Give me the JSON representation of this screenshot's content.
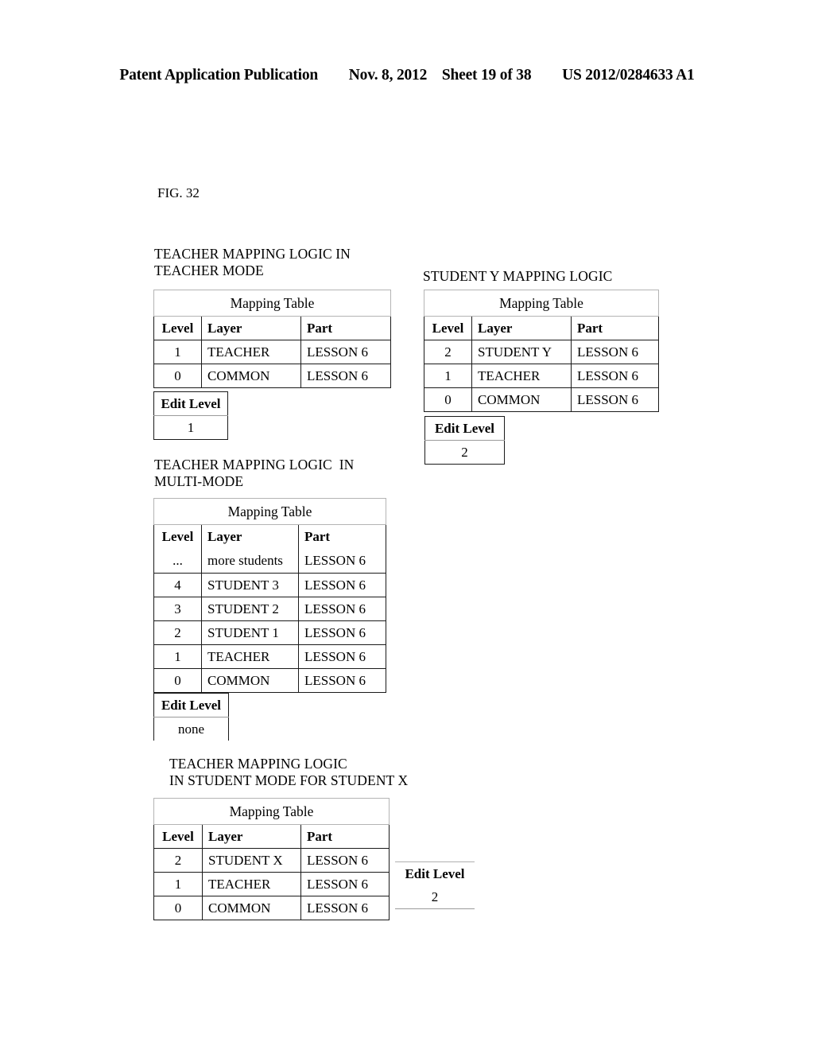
{
  "page_header": {
    "publication": "Patent Application Publication",
    "date": "Nov. 8, 2012",
    "sheet": "Sheet 19 of 38",
    "patent_number": "US 2012/0284633 A1"
  },
  "figure": {
    "label": "FIG. 32"
  },
  "columns": {
    "level": "Level",
    "layer": "Layer",
    "part": "Part"
  },
  "table_title": "Mapping Table",
  "edit_level_label": "Edit Level",
  "sections": {
    "teacher_mode": {
      "caption": "TEACHER MAPPING LOGIC IN\nTEACHER MODE",
      "table_title": "Mapping Table",
      "headers": [
        "Level",
        "Layer",
        "Part"
      ],
      "rows": [
        {
          "level": "1",
          "layer": "TEACHER",
          "part": "LESSON 6"
        },
        {
          "level": "0",
          "layer": "COMMON",
          "part": "LESSON 6"
        }
      ],
      "edit_level_label": "Edit Level",
      "edit_level_value": "1"
    },
    "student_y": {
      "caption": "STUDENT Y MAPPING LOGIC",
      "table_title": "Mapping Table",
      "headers": [
        "Level",
        "Layer",
        "Part"
      ],
      "rows": [
        {
          "level": "2",
          "layer": "STUDENT Y",
          "part": "LESSON 6"
        },
        {
          "level": "1",
          "layer": "TEACHER",
          "part": "LESSON 6"
        },
        {
          "level": "0",
          "layer": "COMMON",
          "part": "LESSON 6"
        }
      ],
      "edit_level_label": "Edit Level",
      "edit_level_value": "2"
    },
    "multi_mode": {
      "caption": "TEACHER MAPPING LOGIC  IN\nMULTI-MODE",
      "table_title": "Mapping Table",
      "headers": [
        "Level",
        "Layer",
        "Part"
      ],
      "rows": [
        {
          "level": "...",
          "layer": "more students",
          "part": "LESSON 6"
        },
        {
          "level": "4",
          "layer": "STUDENT 3",
          "part": "LESSON 6"
        },
        {
          "level": "3",
          "layer": "STUDENT 2",
          "part": "LESSON 6"
        },
        {
          "level": "2",
          "layer": "STUDENT 1",
          "part": "LESSON 6"
        },
        {
          "level": "1",
          "layer": "TEACHER",
          "part": "LESSON 6"
        },
        {
          "level": "0",
          "layer": "COMMON",
          "part": "LESSON 6"
        }
      ],
      "edit_level_label": "Edit Level",
      "edit_level_value": "none"
    },
    "student_x": {
      "caption": "TEACHER MAPPING LOGIC\nIN STUDENT MODE FOR STUDENT X",
      "table_title": "Mapping Table",
      "headers": [
        "Level",
        "Layer",
        "Part"
      ],
      "rows": [
        {
          "level": "2",
          "layer": "STUDENT X",
          "part": "LESSON 6"
        },
        {
          "level": "1",
          "layer": "TEACHER",
          "part": "LESSON 6"
        },
        {
          "level": "0",
          "layer": "COMMON",
          "part": "LESSON 6"
        }
      ],
      "edit_level_label": "Edit Level",
      "edit_level_value": "2"
    }
  }
}
